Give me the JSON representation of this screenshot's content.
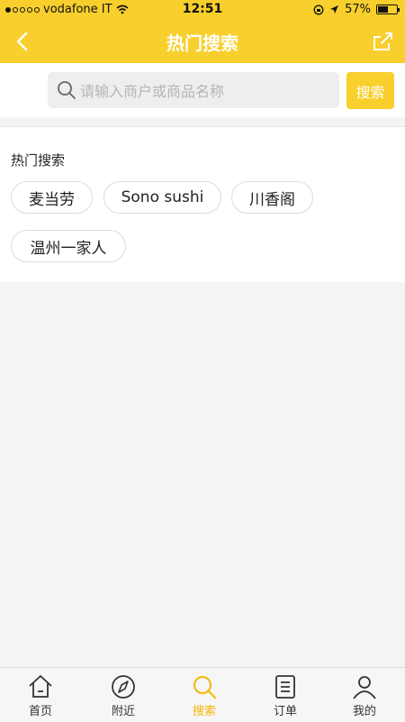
{
  "status_bar": {
    "carrier": "vodafone IT",
    "time": "12:51",
    "battery": "57%",
    "battery_level": 0.57
  },
  "header": {
    "title": "热门搜索"
  },
  "search": {
    "placeholder": "请输入商户或商品名称",
    "value": "",
    "button_label": "搜索"
  },
  "hot": {
    "label": "热门搜索",
    "tags": [
      "麦当劳",
      "Sono sushi",
      "川香阁",
      "温州一家人"
    ]
  },
  "tabbar": {
    "items": [
      {
        "label": "首页",
        "icon": "home-icon"
      },
      {
        "label": "附近",
        "icon": "compass-icon"
      },
      {
        "label": "搜索",
        "icon": "search-icon",
        "active": true
      },
      {
        "label": "订单",
        "icon": "order-list-icon"
      },
      {
        "label": "我的",
        "icon": "person-icon"
      }
    ]
  },
  "colors": {
    "accent": "#f8cf2c",
    "active_tab": "#f5b800"
  }
}
